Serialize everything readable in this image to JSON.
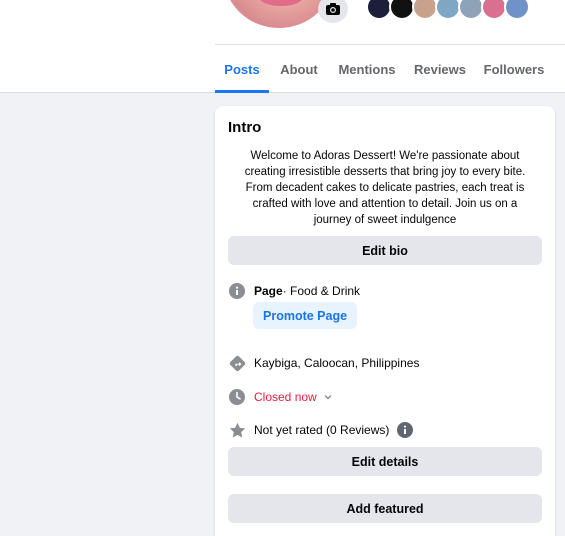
{
  "tabs": [
    {
      "label": "Posts",
      "active": true
    },
    {
      "label": "About",
      "active": false
    },
    {
      "label": "Mentions",
      "active": false
    },
    {
      "label": "Reviews",
      "active": false
    },
    {
      "label": "Followers",
      "active": false
    }
  ],
  "intro": {
    "title": "Intro",
    "bio_lines": [
      "Welcome to Adoras Dessert! We're passionate about",
      "creating irresistible desserts that bring joy to every bite.",
      "From decadent cakes to delicate pastries, each treat is",
      "crafted with love and attention to detail. Join us on a",
      "journey of sweet indulgence"
    ],
    "edit_bio_label": "Edit bio",
    "page_label": "Page",
    "page_category": " · Food & Drink",
    "promote_label": "Promote Page",
    "location": "Kaybiga, Caloocan, Philippines",
    "hours_status": "Closed now",
    "rating": "Not yet rated (0 Reviews)",
    "edit_details_label": "Edit details",
    "add_featured_label": "Add featured"
  },
  "colors": {
    "accent": "#1877f2",
    "closed": "#e41e3f",
    "button_gray": "#e4e6eb",
    "promote_bg": "#e7f3ff"
  },
  "icons": [
    "camera-icon",
    "info-icon",
    "directions-icon",
    "clock-icon",
    "star-icon",
    "chevron-down-icon"
  ]
}
